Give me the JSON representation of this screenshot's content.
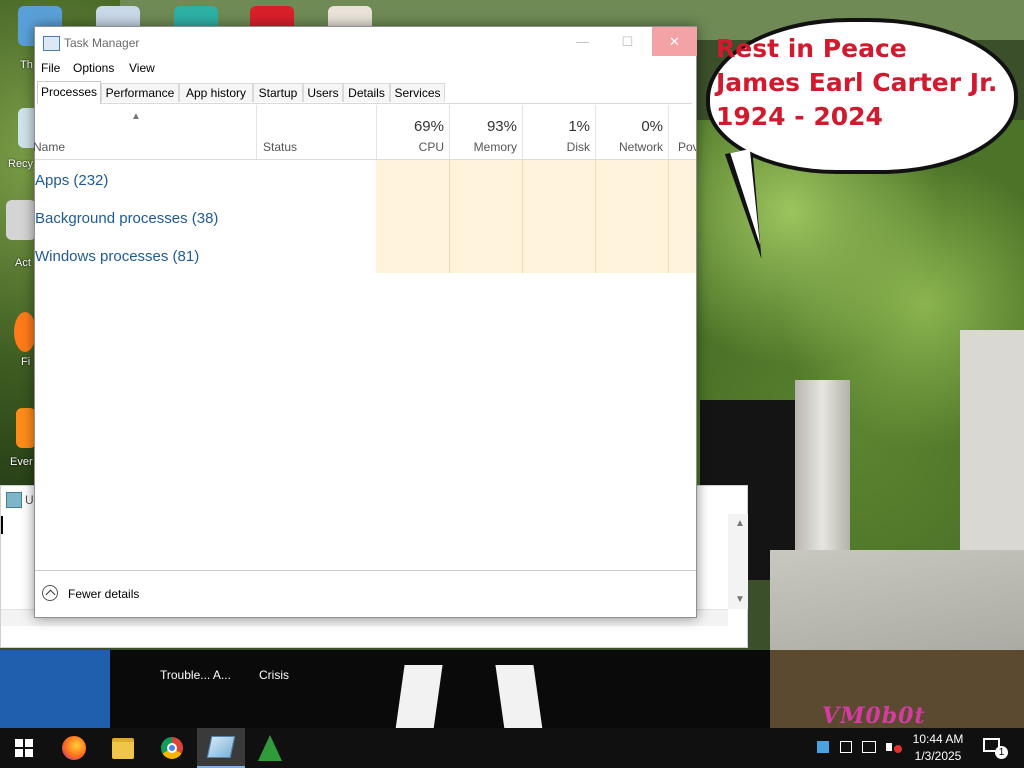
{
  "desktop": {
    "bubble_lines": [
      "Rest in Peace",
      "James Earl Carter Jr.",
      "1924 - 2024"
    ],
    "icon_labels": [
      "Th",
      "Recy",
      "Act",
      "Fi",
      "Ever"
    ],
    "watermark": "VM0b0t",
    "bg_window_title": "U",
    "taskbar_popups": [
      "Trouble... A...",
      "Crisis"
    ]
  },
  "task_manager": {
    "title": "Task Manager",
    "menu": [
      "File",
      "Options",
      "View"
    ],
    "tabs": [
      "Processes",
      "Performance",
      "App history",
      "Startup",
      "Users",
      "Details",
      "Services"
    ],
    "active_tab": "Processes",
    "columns": {
      "name": "Name",
      "status": "Status",
      "cpu": {
        "pct": "69%",
        "label": "CPU"
      },
      "memory": {
        "pct": "93%",
        "label": "Memory"
      },
      "disk": {
        "pct": "1%",
        "label": "Disk"
      },
      "network": {
        "pct": "0%",
        "label": "Network"
      },
      "power": "Pov"
    },
    "groups": [
      "Apps (232)",
      "Background processes (38)",
      "Windows processes (81)"
    ],
    "fewer_details": "Fewer details",
    "window_buttons": {
      "minimize": "—",
      "maximize": "☐",
      "close": "✕"
    }
  },
  "taskbar": {
    "pinned": [
      "start-button",
      "firefox",
      "file-explorer",
      "chrome",
      "task-manager",
      "tree-app"
    ],
    "clock_time": "10:44 AM",
    "clock_date": "1/3/2025",
    "notification_count": "1"
  },
  "colors": {
    "heat": "#fff4db",
    "group_text": "#1e5a96",
    "bubble_text": "#d11a2e",
    "close_button": "#f3a3a6"
  }
}
